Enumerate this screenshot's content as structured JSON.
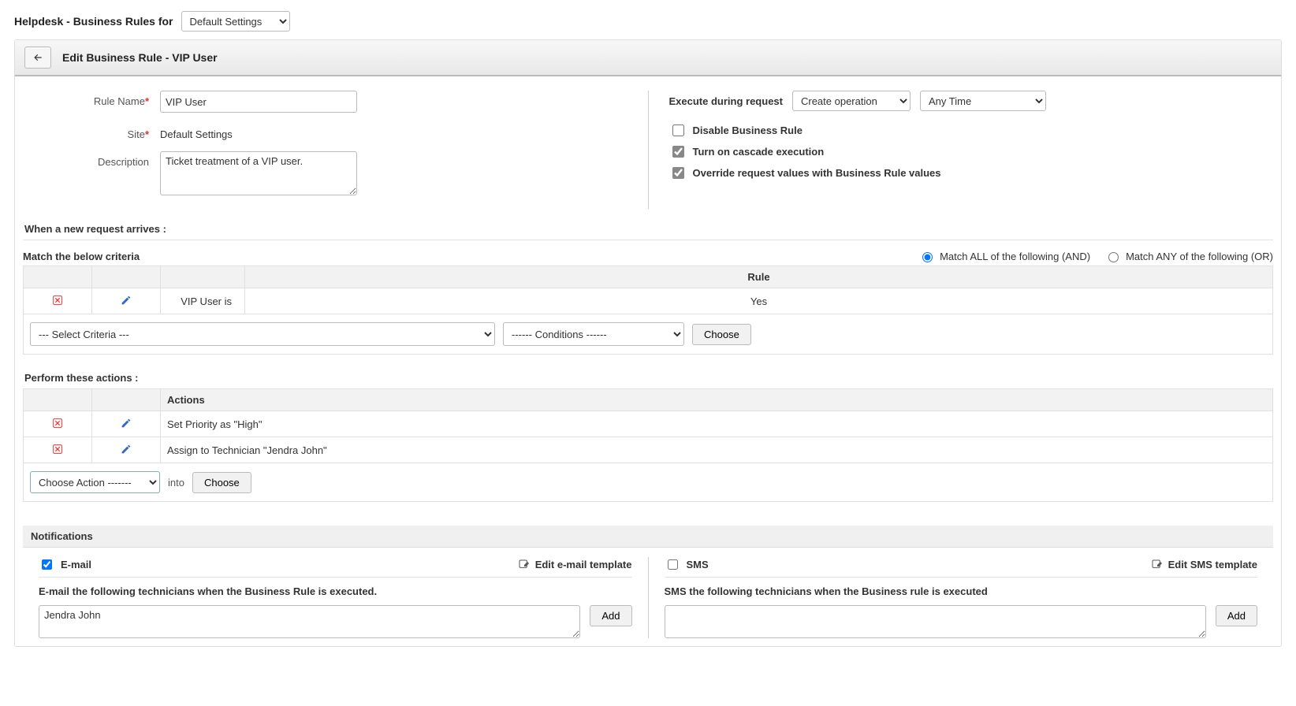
{
  "top": {
    "title": "Helpdesk - Business Rules  for",
    "siteSelect": "Default Settings"
  },
  "header": {
    "title": "Edit Business Rule - VIP User"
  },
  "form": {
    "labels": {
      "ruleName": "Rule Name",
      "site": "Site",
      "description": "Description"
    },
    "ruleName": "VIP User",
    "siteValue": "Default Settings",
    "description": "Ticket treatment of a VIP user."
  },
  "exec": {
    "label": "Execute during request",
    "op": "Create operation",
    "time": "Any Time",
    "disable": "Disable Business Rule",
    "cascade": "Turn on cascade execution",
    "override": "Override request values with Business Rule values"
  },
  "criteria": {
    "arriveLabel": "When a new request arrives :",
    "matchLabel": "Match the below criteria",
    "matchAll": "Match ALL of the following (AND)",
    "matchAny": "Match ANY of the following (OR)",
    "headerRule": "Rule",
    "rowField": "VIP User is",
    "rowValue": "Yes",
    "selCriteria": "--- Select Criteria ---",
    "selCond": "------ Conditions ------",
    "choose": "Choose"
  },
  "actions": {
    "label": "Perform these actions :",
    "header": "Actions",
    "rows": [
      "Set Priority as \"High\"",
      "Assign to Technician \"Jendra John\""
    ],
    "chooseAction": "Choose Action -------",
    "into": "into",
    "choose": "Choose"
  },
  "notif": {
    "header": "Notifications",
    "email": {
      "label": "E-mail",
      "edit": "Edit e-mail template",
      "sub": "E-mail the following technicians when the Business Rule is executed.",
      "value": "Jendra John",
      "add": "Add"
    },
    "sms": {
      "label": "SMS",
      "edit": "Edit SMS template",
      "sub": "SMS the following technicians when the Business rule is executed",
      "value": "",
      "add": "Add"
    }
  }
}
